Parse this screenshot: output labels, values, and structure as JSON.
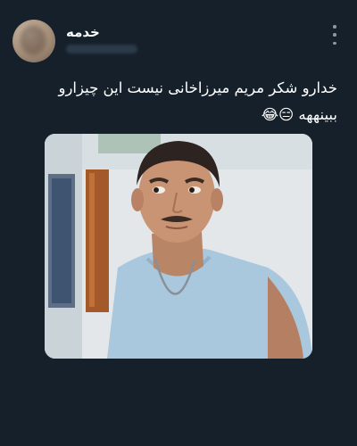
{
  "tweet": {
    "author": {
      "display_name": "خدمه"
    },
    "text_line_1": "خدارو شکر مریم میرزاخانی نیست این چیزارو",
    "text_line_2": "ببینههه 😑😂",
    "media": {
      "type": "photo",
      "subject": "man-looking-sideways-meme"
    },
    "icons": {
      "menu": "more-vertical-icon"
    }
  }
}
